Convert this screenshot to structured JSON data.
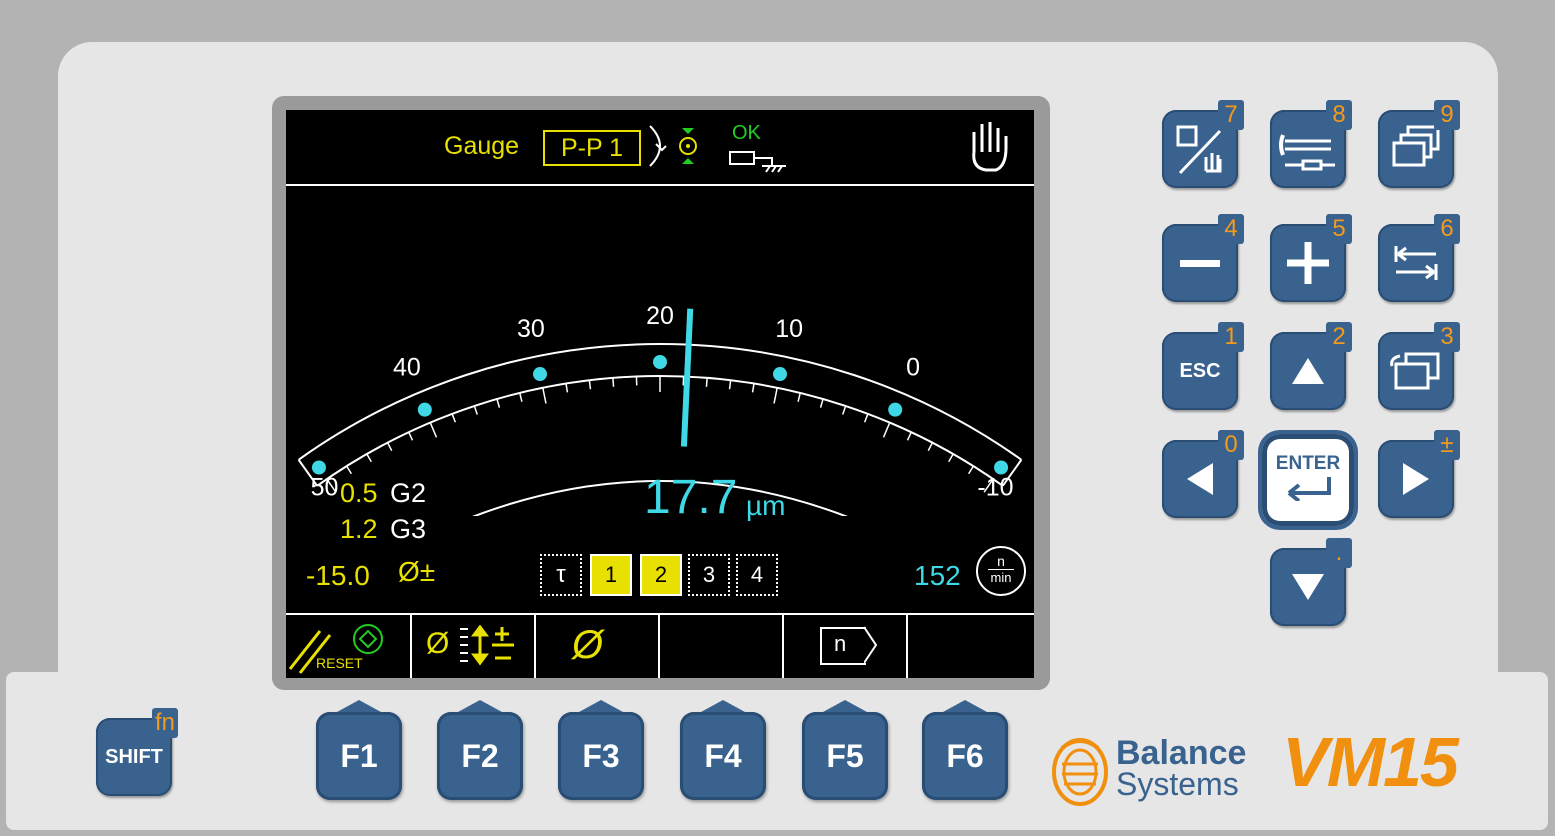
{
  "screen": {
    "gauge_label": "Gauge",
    "gauge_value": "P-P 1",
    "status_ok": "OK",
    "scale": {
      "label_values": [
        "50",
        "40",
        "30",
        "20",
        "10",
        "0",
        "-10"
      ],
      "label_positions": [
        50,
        40,
        30,
        20,
        10,
        0,
        -10
      ],
      "dots": [
        50,
        40,
        30,
        20,
        10,
        0,
        -10
      ],
      "range": [
        50,
        -10
      ],
      "needle_value": 17.7
    },
    "readout_value": "17.7",
    "readout_unit": "µm",
    "g2_value": "0.5",
    "g2_label": "G2",
    "g3_value": "1.2",
    "g3_label": "G3",
    "offset_value": "-15.0",
    "offset_symbol": "Ø±",
    "tau_symbol": "τ",
    "channels": [
      {
        "label": "1",
        "active": true
      },
      {
        "label": "2",
        "active": true
      },
      {
        "label": "3",
        "active": false
      },
      {
        "label": "4",
        "active": false
      }
    ],
    "speed_value": "152",
    "speed_unit_top": "n",
    "speed_unit_bottom": "min",
    "softkeys": {
      "f1_label": "RESET",
      "f2_symbol": "Ø",
      "f3_symbol": "Ø",
      "f5_symbol": "n"
    }
  },
  "keypad": {
    "k7": "7",
    "k8": "8",
    "k9": "9",
    "k4": "4",
    "k5": "5",
    "k6": "6",
    "k1": "1",
    "k2": "2",
    "k3": "3",
    "k0": "0",
    "kpm": "±",
    "kdot": ".",
    "esc_label": "ESC",
    "enter_label": "ENTER"
  },
  "function_keys": [
    "F1",
    "F2",
    "F3",
    "F4",
    "F5",
    "F6"
  ],
  "shift": {
    "label": "SHIFT",
    "fn": "fn"
  },
  "brand": {
    "line1": "Balance",
    "line2": "Systems",
    "model": "VM15"
  },
  "colors": {
    "accent_cyan": "#3fd8e6",
    "accent_yellow": "#e8e000",
    "key_blue": "#39628f",
    "key_number": "#f39a1c",
    "brand_orange": "#f0900e"
  }
}
